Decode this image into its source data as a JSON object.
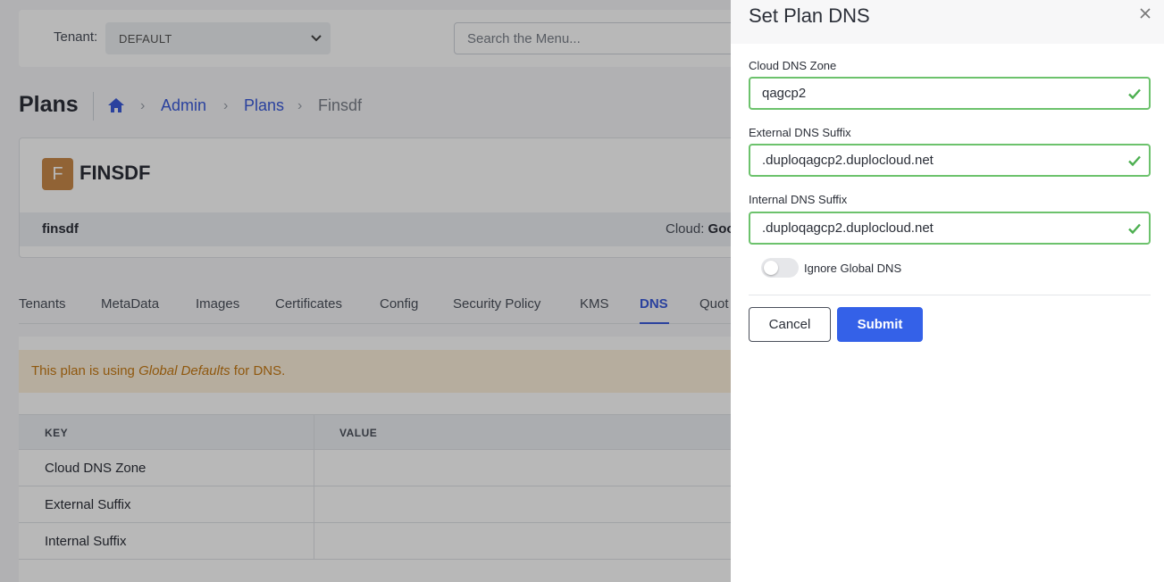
{
  "topbar": {
    "tenant_label": "Tenant:",
    "tenant_value": "DEFAULT",
    "search_placeholder": "Search the Menu..."
  },
  "page": {
    "title": "Plans",
    "breadcrumb": [
      "Admin",
      "Plans",
      "Finsdf"
    ]
  },
  "plan_card": {
    "avatar_letter": "F",
    "name": "FINSDF",
    "id": "finsdf",
    "cloud_label": "Cloud:",
    "cloud_value": "Goo"
  },
  "tabs": [
    "Tenants",
    "MetaData",
    "Images",
    "Certificates",
    "Config",
    "Security Policy",
    "KMS",
    "DNS",
    "Quot"
  ],
  "active_tab": "DNS",
  "alert": {
    "prefix": "This plan is using ",
    "emphasis": "Global Defaults",
    "suffix": " for DNS."
  },
  "table": {
    "headers": [
      "KEY",
      "VALUE"
    ],
    "rows": [
      "Cloud DNS Zone",
      "External Suffix",
      "Internal Suffix"
    ]
  },
  "drawer": {
    "title": "Set Plan DNS",
    "fields": {
      "cloud_dns_zone": {
        "label": "Cloud DNS Zone",
        "value": "qagcp2"
      },
      "external_dns_suffix": {
        "label": "External DNS Suffix",
        "value": ".duploqagcp2.duplocloud.net"
      },
      "internal_dns_suffix": {
        "label": "Internal DNS Suffix",
        "value": ".duploqagcp2.duplocloud.net"
      }
    },
    "ignore_global_dns": {
      "label": "Ignore Global DNS",
      "checked": false
    },
    "cancel_label": "Cancel",
    "submit_label": "Submit"
  },
  "colors": {
    "accent": "#3461e8",
    "link": "#3b5bdb",
    "valid": "#6cc26c",
    "alert_text": "#c77a14",
    "alert_bg": "#fdf0dc",
    "avatar": "#c98a4a"
  }
}
